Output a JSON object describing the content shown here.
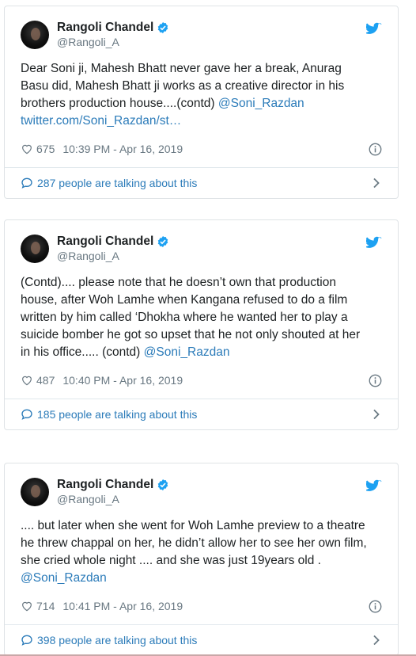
{
  "tweets": [
    {
      "name": "Rangoli Chandel",
      "handle": "@Rangoli_A",
      "text": "Dear Soni ji, Mahesh Bhatt never gave her a break, Anurag\nBasu did, Mahesh Bhatt ji works as a creative director in his\nbrothers production house....(contd) ",
      "mention": "@Soni_Razdan",
      "url": "twitter.com/Soni_Razdan/st…",
      "likes": "675",
      "timestamp": "10:39 PM - Apr 16, 2019",
      "talking": "287 people are talking about this"
    },
    {
      "name": "Rangoli Chandel",
      "handle": "@Rangoli_A",
      "text": "(Contd).... please note that he doesn’t own that production\nhouse, after Woh Lamhe when Kangana refused to do a film\nwritten by him called ‘Dhokha where he wanted her to play a\nsuicide bomber he got so upset that he not only shouted at her\nin his office..... (contd) ",
      "mention": "@Soni_Razdan",
      "likes": "487",
      "timestamp": "10:40 PM - Apr 16, 2019",
      "talking": "185 people are talking about this"
    },
    {
      "name": "Rangoli Chandel",
      "handle": "@Rangoli_A",
      "text": ".... but later when she went for Woh Lamhe preview to a theatre\nhe threw chappal on her, he didn’t allow her to see her own film,\nshe cried whole night .... and she was just 19years old .\n",
      "mention": "@Soni_Razdan",
      "likes": "714",
      "timestamp": "10:41 PM - Apr 16, 2019",
      "talking": "398 people are talking about this"
    }
  ],
  "icons": {
    "verified": "verified-badge-icon",
    "bird": "twitter-bird-icon",
    "heart": "heart-icon",
    "info": "info-icon",
    "bubble": "speech-bubble-icon",
    "chevron": "chevron-right-icon"
  },
  "colors": {
    "link": "#2b7bb9",
    "muted": "#697882",
    "twitter_blue": "#1da1f2"
  }
}
